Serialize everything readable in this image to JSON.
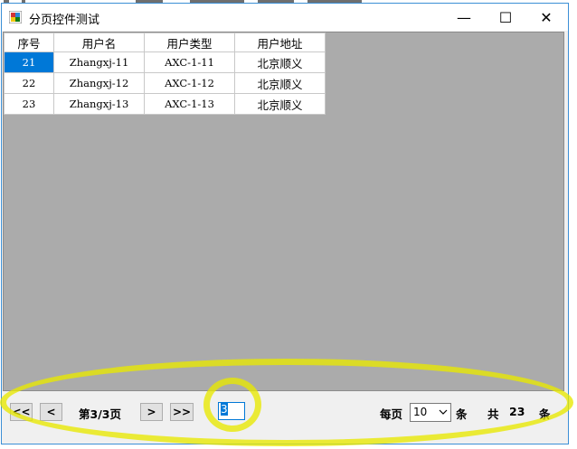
{
  "window": {
    "title": "分页控件测试",
    "controls": {
      "minimize": "—",
      "maximize": "☐",
      "close": "✕"
    }
  },
  "grid": {
    "columns": [
      "序号",
      "用户名",
      "用户类型",
      "用户地址"
    ],
    "rows": [
      [
        "21",
        "Zhangxj-11",
        "AXC-1-11",
        "北京顺义"
      ],
      [
        "22",
        "Zhangxj-12",
        "AXC-1-12",
        "北京顺义"
      ],
      [
        "23",
        "Zhangxj-13",
        "AXC-1-13",
        "北京顺义"
      ]
    ],
    "selected_cell": "21"
  },
  "pager": {
    "first_label": "<<",
    "prev_label": "<",
    "page_info": "第3/3页",
    "next_label": ">",
    "last_label": ">>",
    "goto_value": "3",
    "per_page_label": "每页",
    "per_page_value": "10",
    "per_page_unit": "条",
    "total_label": "共",
    "total_count": "23",
    "total_unit": "条"
  },
  "colors": {
    "selection": "#0078d7",
    "grid_background": "#ababab",
    "highlight": "#e8e800"
  }
}
